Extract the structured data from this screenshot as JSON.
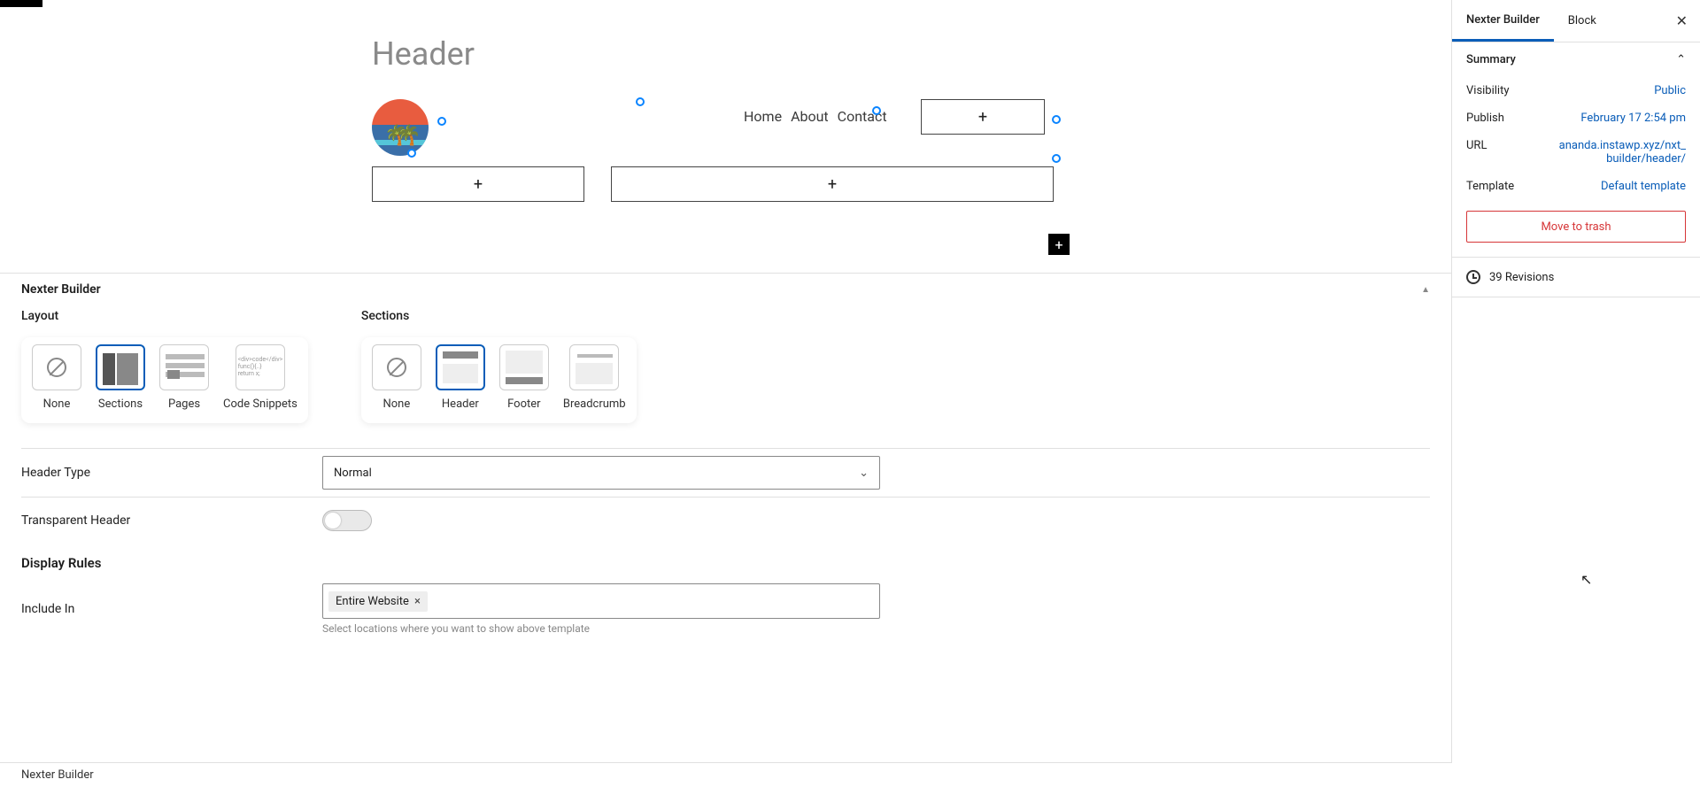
{
  "page": {
    "title": "Header"
  },
  "nav": {
    "items": [
      "Home",
      "About",
      "Contact"
    ]
  },
  "panel": {
    "title": "Nexter Builder",
    "layout_label": "Layout",
    "sections_label": "Sections",
    "layout_options": [
      {
        "label": "None"
      },
      {
        "label": "Sections"
      },
      {
        "label": "Pages"
      },
      {
        "label": "Code Snippets"
      }
    ],
    "section_options": [
      {
        "label": "None"
      },
      {
        "label": "Header"
      },
      {
        "label": "Footer"
      },
      {
        "label": "Breadcrumb"
      }
    ],
    "header_type_label": "Header Type",
    "header_type_value": "Normal",
    "transparent_label": "Transparent Header",
    "display_rules_label": "Display Rules",
    "include_in_label": "Include In",
    "include_tag": "Entire Website",
    "include_hint": "Select locations where you want to show above template"
  },
  "footerbar": {
    "text": "Nexter Builder"
  },
  "sidebar": {
    "tabs": {
      "builder": "Nexter Builder",
      "block": "Block"
    },
    "summary": {
      "title": "Summary",
      "visibility_k": "Visibility",
      "visibility_v": "Public",
      "publish_k": "Publish",
      "publish_v": "February 17 2:54 pm",
      "url_k": "URL",
      "url_v": "ananda.instawp.xyz/nxt_builder/header/",
      "template_k": "Template",
      "template_v": "Default template",
      "trash": "Move to trash"
    },
    "revisions": "39 Revisions"
  }
}
